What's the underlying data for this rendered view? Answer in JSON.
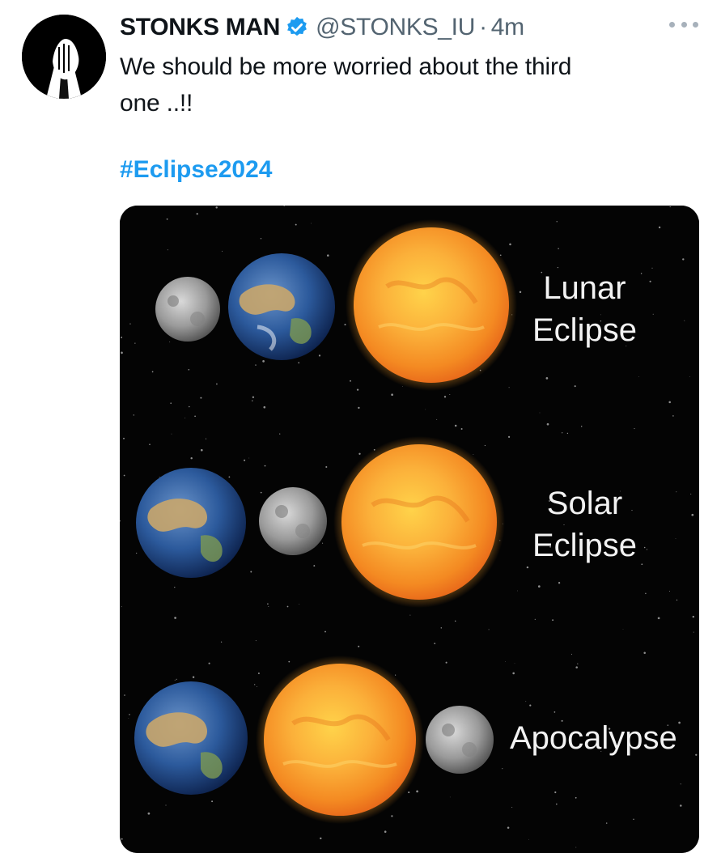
{
  "tweet": {
    "author": {
      "display_name": "STONKS MAN",
      "handle": "@STONKS_IU",
      "verified_icon": "verified-badge-icon",
      "avatar": "avatar-hands-steepled"
    },
    "timestamp": "4m",
    "separator": "·",
    "text_line_1": "We should be more worried about the third",
    "text_line_2": "one ..!!",
    "hashtag": "#Eclipse2024",
    "more_icon": "more-options-icon"
  },
  "media": {
    "labels": {
      "lunar_line1": "Lunar",
      "lunar_line2": "Eclipse",
      "solar_line1": "Solar",
      "solar_line2": "Eclipse",
      "apocalypse": "Apocalypse"
    },
    "objects": [
      "moon",
      "earth",
      "sun"
    ]
  },
  "colors": {
    "link": "#1d9bf0",
    "secondary_text": "#536471",
    "primary_text": "#0f1419",
    "verified": "#1d9bf0",
    "space": "#040404"
  }
}
